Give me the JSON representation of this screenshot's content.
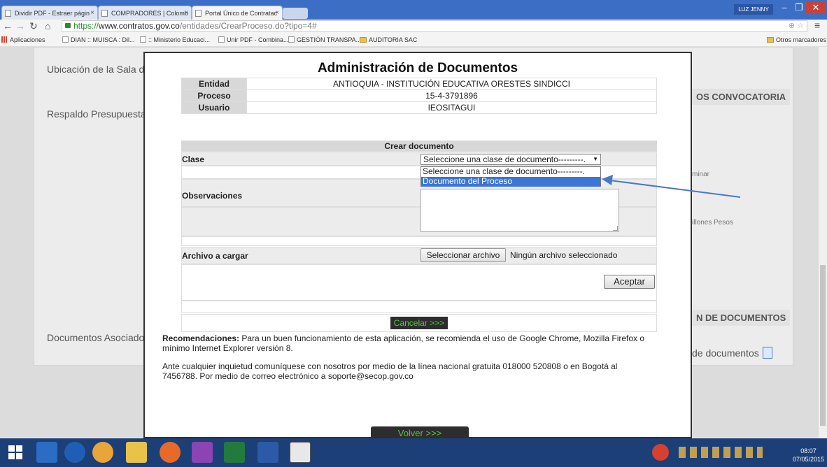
{
  "browser": {
    "tabs": [
      {
        "label": "Dividir PDF - Estraer págin",
        "active": false
      },
      {
        "label": "COMPRADORES | Colomb",
        "active": false
      },
      {
        "label": "Portal Único de Contratac",
        "active": true
      }
    ],
    "user_badge": "LUZ JENNY",
    "url_secure": "https://",
    "url_host": "www.contratos.gov.co",
    "url_path": "/entidades/CrearProceso.do?tipo=4#",
    "bookmarks": [
      "Aplicaciones",
      "DIAN :: MUISCA : Dil...",
      ":: Ministerio Educaci...",
      "Unir PDF - Combina...",
      "GESTIÓN TRANSPA...",
      "AUDITORIA SAC"
    ],
    "other_bookmarks": "Otros marcadores"
  },
  "background_page": {
    "ubicacion": "Ubicación de la Sala de",
    "respaldo": "Respaldo Presupuestal",
    "documentos_asociados": "Documentos Asociados",
    "convocatoria_header": "OS CONVOCATORIA",
    "documentos_header": "N DE DOCUMENTOS",
    "minar": "minar",
    "millones": "illones Pesos",
    "de_documentos": "de documentos"
  },
  "modal": {
    "title": "Administración de Documentos",
    "info": [
      {
        "label": "Entidad",
        "value": "ANTIOQUIA - INSTITUCIÓN EDUCATIVA ORESTES SINDICCI"
      },
      {
        "label": "Proceso",
        "value": "15-4-3791896"
      },
      {
        "label": "Usuario",
        "value": "IEOSITAGUI"
      }
    ],
    "form_header": "Crear documento",
    "clase_label": "Clase",
    "clase_selected": "Seleccione una clase de documento---------.",
    "clase_options": [
      "Seleccione una clase de documento---------.",
      "Documento del Proceso"
    ],
    "observaciones_label": "Observaciones",
    "archivo_label": "Archivo a cargar",
    "file_button": "Seleccionar archivo",
    "file_status": "Ningún archivo seleccionado",
    "aceptar": "Aceptar",
    "cancelar": "Cancelar >>>",
    "recomendaciones_title": "Recomendaciones:",
    "recomendaciones_text": " Para un buen funcionamiento de esta aplicación, se recomienda el uso de Google Chrome, Mozilla Firefox o mínimo Internet Explorer versión 8.",
    "contacto_text": "Ante cualquier inquietud comuníquese con nosotros por medio de la línea nacional gratuita 018000 520808 o en Bogotá al 7456788. Por medio de correo electrónico a soporte@secop.gov.co",
    "volver": "Volver >>>"
  },
  "taskbar": {
    "time": "08:07",
    "date": "07/05/2015"
  },
  "colors": {
    "selected_option": "#3b76d6",
    "green_link": "#5ec34a",
    "annotation_arrow": "#4a78c2"
  }
}
